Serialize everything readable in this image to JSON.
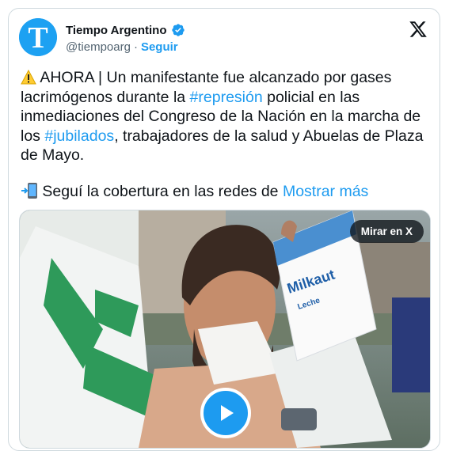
{
  "author": {
    "name": "Tiempo Argentino",
    "handle": "@tiempoarg",
    "separator": "·",
    "follow_label": "Seguir",
    "verified": true,
    "avatar_letter": "T"
  },
  "tweet": {
    "part1": " AHORA | Un manifestante fue alcanzado por gases lacrimógenos durante la ",
    "hashtag1": "#represión",
    "part2": " policial en las inmediaciones del Congreso de la Nación en la marcha de los ",
    "hashtag2": "#jubilados",
    "part3": ", trabajadores de la salud y Abuelas de Plaza de Mayo.",
    "line2_text": " Seguí la cobertura en las redes de ",
    "show_more": "Mostrar más"
  },
  "media": {
    "watch_label": "Mirar en X",
    "carton_brand": "Milkaut",
    "carton_label": "Leche"
  },
  "colors": {
    "accent": "#1d9bf0",
    "text": "#0f1419",
    "muted": "#536471",
    "border": "#cfd9de"
  },
  "icons": {
    "warning": "warning-icon",
    "phone": "mobile-arrow-icon",
    "platform": "x-logo-icon",
    "verified": "verified-badge-icon",
    "play": "play-icon"
  }
}
